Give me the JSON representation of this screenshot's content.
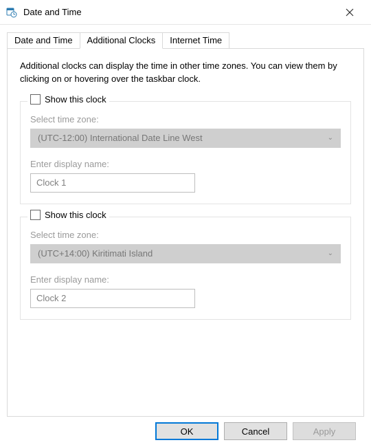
{
  "window": {
    "title": "Date and Time"
  },
  "tabs": {
    "t0": "Date and Time",
    "t1": "Additional Clocks",
    "t2": "Internet Time"
  },
  "panel": {
    "description": "Additional clocks can display the time in other time zones. You can view them by clicking on or hovering over the taskbar clock."
  },
  "clock1": {
    "show_label": "Show this clock",
    "tz_label": "Select time zone:",
    "tz_value": "(UTC-12:00) International Date Line West",
    "name_label": "Enter display name:",
    "name_value": "Clock 1"
  },
  "clock2": {
    "show_label": "Show this clock",
    "tz_label": "Select time zone:",
    "tz_value": "(UTC+14:00) Kiritimati Island",
    "name_label": "Enter display name:",
    "name_value": "Clock 2"
  },
  "buttons": {
    "ok": "OK",
    "cancel": "Cancel",
    "apply": "Apply"
  }
}
